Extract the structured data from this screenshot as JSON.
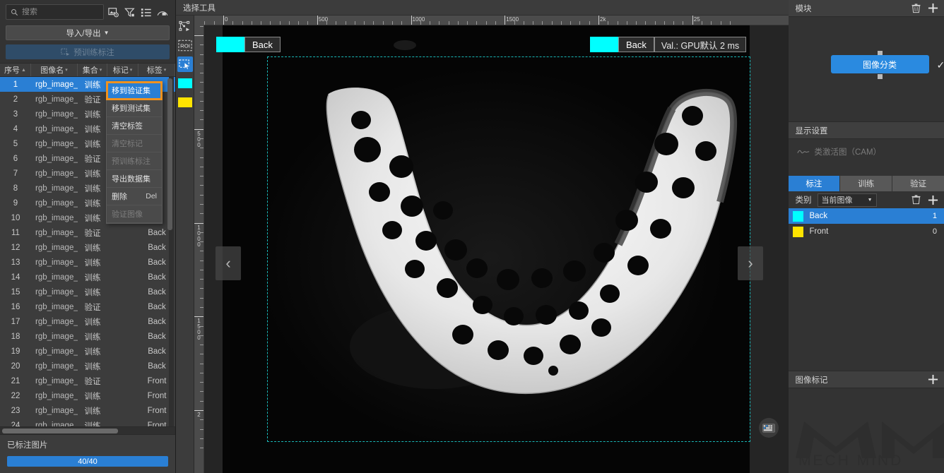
{
  "left": {
    "search": {
      "placeholder": "搜索",
      "value": "",
      "icon": "search-icon"
    },
    "toolbar_icons": [
      "image-settings-icon",
      "filter-icon",
      "list-view-icon",
      "mask-shape-icon"
    ],
    "import_export_label": "导入/导出",
    "pretrain_label": "预训练标注",
    "columns": [
      {
        "label": "序号",
        "sort": "▲"
      },
      {
        "label": "图像名",
        "sort": "▾"
      },
      {
        "label": "集合",
        "sort": "▾"
      },
      {
        "label": "标记",
        "sort": "▾"
      },
      {
        "label": "标签",
        "sort": "▾"
      }
    ],
    "rows": [
      {
        "idx": "1",
        "name": "rgb_image_...",
        "set": "训练",
        "mark": "",
        "tag": ""
      },
      {
        "idx": "2",
        "name": "rgb_image_...",
        "set": "验证",
        "mark": "",
        "tag": ""
      },
      {
        "idx": "3",
        "name": "rgb_image_...",
        "set": "训练",
        "mark": "",
        "tag": ""
      },
      {
        "idx": "4",
        "name": "rgb_image_...",
        "set": "训练",
        "mark": "",
        "tag": ""
      },
      {
        "idx": "5",
        "name": "rgb_image_...",
        "set": "训练",
        "mark": "",
        "tag": ""
      },
      {
        "idx": "6",
        "name": "rgb_image_...",
        "set": "验证",
        "mark": "",
        "tag": ""
      },
      {
        "idx": "7",
        "name": "rgb_image_...",
        "set": "训练",
        "mark": "",
        "tag": ""
      },
      {
        "idx": "8",
        "name": "rgb_image_...",
        "set": "训练",
        "mark": "",
        "tag": ""
      },
      {
        "idx": "9",
        "name": "rgb_image_...",
        "set": "训练",
        "mark": "",
        "tag": ""
      },
      {
        "idx": "10",
        "name": "rgb_image_...",
        "set": "训练",
        "mark": "",
        "tag": ""
      },
      {
        "idx": "11",
        "name": "rgb_image_...",
        "set": "验证",
        "mark": "",
        "tag": "Back"
      },
      {
        "idx": "12",
        "name": "rgb_image_...",
        "set": "训练",
        "mark": "",
        "tag": "Back"
      },
      {
        "idx": "13",
        "name": "rgb_image_...",
        "set": "训练",
        "mark": "",
        "tag": "Back"
      },
      {
        "idx": "14",
        "name": "rgb_image_...",
        "set": "训练",
        "mark": "",
        "tag": "Back"
      },
      {
        "idx": "15",
        "name": "rgb_image_...",
        "set": "训练",
        "mark": "",
        "tag": "Back"
      },
      {
        "idx": "16",
        "name": "rgb_image_...",
        "set": "验证",
        "mark": "",
        "tag": "Back"
      },
      {
        "idx": "17",
        "name": "rgb_image_...",
        "set": "训练",
        "mark": "",
        "tag": "Back"
      },
      {
        "idx": "18",
        "name": "rgb_image_...",
        "set": "训练",
        "mark": "",
        "tag": "Back"
      },
      {
        "idx": "19",
        "name": "rgb_image_...",
        "set": "训练",
        "mark": "",
        "tag": "Back"
      },
      {
        "idx": "20",
        "name": "rgb_image_...",
        "set": "训练",
        "mark": "",
        "tag": "Back"
      },
      {
        "idx": "21",
        "name": "rgb_image_...",
        "set": "验证",
        "mark": "",
        "tag": "Front"
      },
      {
        "idx": "22",
        "name": "rgb_image_...",
        "set": "训练",
        "mark": "",
        "tag": "Front"
      },
      {
        "idx": "23",
        "name": "rgb_image_...",
        "set": "训练",
        "mark": "",
        "tag": "Front"
      },
      {
        "idx": "24",
        "name": "rgb_image_...",
        "set": "训练",
        "mark": "",
        "tag": "Front"
      }
    ],
    "selected_row_index": 0,
    "footer_title": "已标注图片",
    "progress_label": "40/40"
  },
  "context_menu": {
    "items": [
      {
        "label": "移到验证集",
        "shortcut": "",
        "disabled": false,
        "highlighted": true
      },
      {
        "label": "移到测试集",
        "shortcut": "",
        "disabled": false,
        "highlighted": false
      },
      {
        "label": "清空标签",
        "shortcut": "",
        "disabled": false,
        "highlighted": false
      },
      {
        "label": "清空标记",
        "shortcut": "",
        "disabled": true,
        "highlighted": false
      },
      {
        "label": "预训练标注",
        "shortcut": "",
        "disabled": true,
        "highlighted": false
      },
      {
        "label": "导出数据集",
        "shortcut": "",
        "disabled": false,
        "highlighted": false
      },
      {
        "label": "删除",
        "shortcut": "Del",
        "disabled": false,
        "highlighted": false
      },
      {
        "label": "验证图像",
        "shortcut": "",
        "disabled": true,
        "highlighted": false
      }
    ],
    "highlight_color": "#f0921e"
  },
  "center": {
    "header_title": "选择工具",
    "tools": [
      {
        "name": "polygon-node-icon",
        "active": false
      },
      {
        "name": "roi-icon",
        "label": "ROI",
        "active": false
      },
      {
        "name": "select-tool-icon",
        "active": true
      },
      {
        "name": "class-color-cyan-swatch",
        "color": "#00ffff",
        "active": false
      },
      {
        "name": "class-color-yellow-swatch",
        "color": "#ffe400",
        "active": false
      }
    ],
    "ruler_h_labels": [
      "0",
      "500",
      "1000",
      "1500",
      "2k",
      "25"
    ],
    "ruler_v_labels": [
      "500",
      "1000",
      "1500",
      "2"
    ],
    "overlay_tag_left": "Back",
    "overlay_tag_left_color": "#00ffff",
    "overlay_tag_right": "Back",
    "overlay_tag_right_color": "#00ffff",
    "val_chip": "Val.:  GPU默认 2 ms",
    "prev_label": "‹",
    "next_label": "›",
    "keyboard_icon": "keyboard-icon"
  },
  "right": {
    "modules": {
      "title": "模块",
      "delete_icon": "trash-icon",
      "add_icon": "plus-icon",
      "node_label": "图像分类",
      "node_check": "✓"
    },
    "display_settings": {
      "title": "显示设置",
      "cam_label": "类激活图（CAM）",
      "cam_icon": "cam-wave-icon"
    },
    "tabs": [
      {
        "label": "标注",
        "active": true
      },
      {
        "label": "训练",
        "active": false
      },
      {
        "label": "验证",
        "active": false
      }
    ],
    "category_row": {
      "label": "类别",
      "select_value": "当前图像",
      "delete_icon": "trash-icon",
      "add_icon": "plus-icon"
    },
    "classes": [
      {
        "name": "Back",
        "color": "#00ffff",
        "count": "1",
        "selected": true
      },
      {
        "name": "Front",
        "color": "#ffe400",
        "count": "0",
        "selected": false
      }
    ],
    "image_marks": {
      "title": "图像标记",
      "add_icon": "plus-icon"
    },
    "watermark": "MECH MIND"
  }
}
